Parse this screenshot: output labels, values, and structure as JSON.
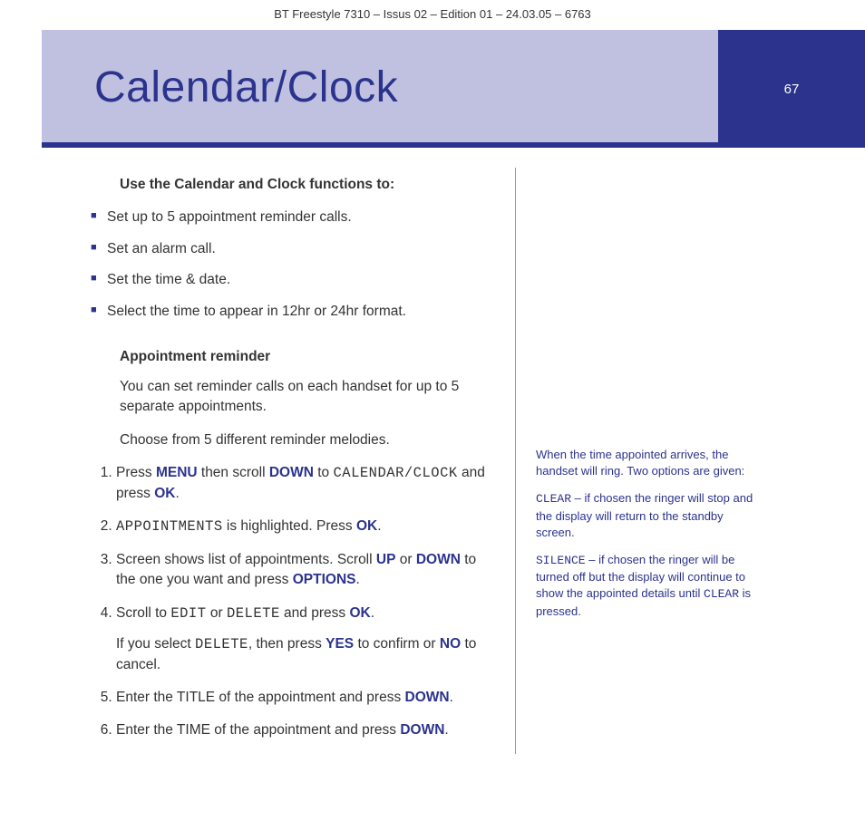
{
  "header": "BT Freestyle 7310 – Issus 02 – Edition 01 – 24.03.05 – 6763",
  "page_number": "67",
  "title": "Calendar/Clock",
  "intro_head": "Use the Calendar and Clock functions to:",
  "bullets": [
    "Set up to 5 appointment reminder calls.",
    "Set an alarm call.",
    "Set the time & date.",
    "Select the time to appear in 12hr or 24hr format."
  ],
  "sub_head": "Appointment reminder",
  "sub_p1": "You can set reminder calls on each handset for up to 5 separate appointments.",
  "sub_p2": "Choose from 5 different reminder melodies.",
  "steps": {
    "s1_a": "Press ",
    "s1_menu": "MENU",
    "s1_b": " then scroll ",
    "s1_down": "DOWN",
    "s1_c": " to ",
    "s1_lcd": "CALENDAR/CLOCK",
    "s1_d": " and press ",
    "s1_ok": "OK",
    "s1_e": ".",
    "s2_lcd": "APPOINTMENTS",
    "s2_a": " is highlighted. Press ",
    "s2_ok": "OK",
    "s2_b": ".",
    "s3_a": "Screen shows list of appointments. Scroll ",
    "s3_up": "UP",
    "s3_b": " or ",
    "s3_down": "DOWN",
    "s3_c": " to the one you want and press ",
    "s3_opt": "OPTIONS",
    "s3_d": ".",
    "s4_a": "Scroll to ",
    "s4_edit": "EDIT",
    "s4_b": " or ",
    "s4_del": "DELETE",
    "s4_c": " and press ",
    "s4_ok": "OK",
    "s4_d": ".",
    "s4x_a": "If you select ",
    "s4x_del": "DELETE",
    "s4x_b": ", then press ",
    "s4x_yes": "YES",
    "s4x_c": " to confirm or ",
    "s4x_no": "NO",
    "s4x_d": " to cancel.",
    "s5_a": "Enter the TITLE of the appointment and press ",
    "s5_down": "DOWN",
    "s5_b": ".",
    "s6_a": "Enter the TIME of the appointment and press ",
    "s6_down": "DOWN",
    "s6_b": "."
  },
  "side": {
    "p1": "When the time appointed arrives, the handset will ring. Two options are given:",
    "p2a": "CLEAR",
    "p2b": " – if chosen the ringer will stop and the display will return to the standby screen.",
    "p3a": "SILENCE",
    "p3b": " – if chosen the ringer will be turned off but the display will continue to show the appointed details until ",
    "p3c": "CLEAR",
    "p3d": " is pressed."
  }
}
